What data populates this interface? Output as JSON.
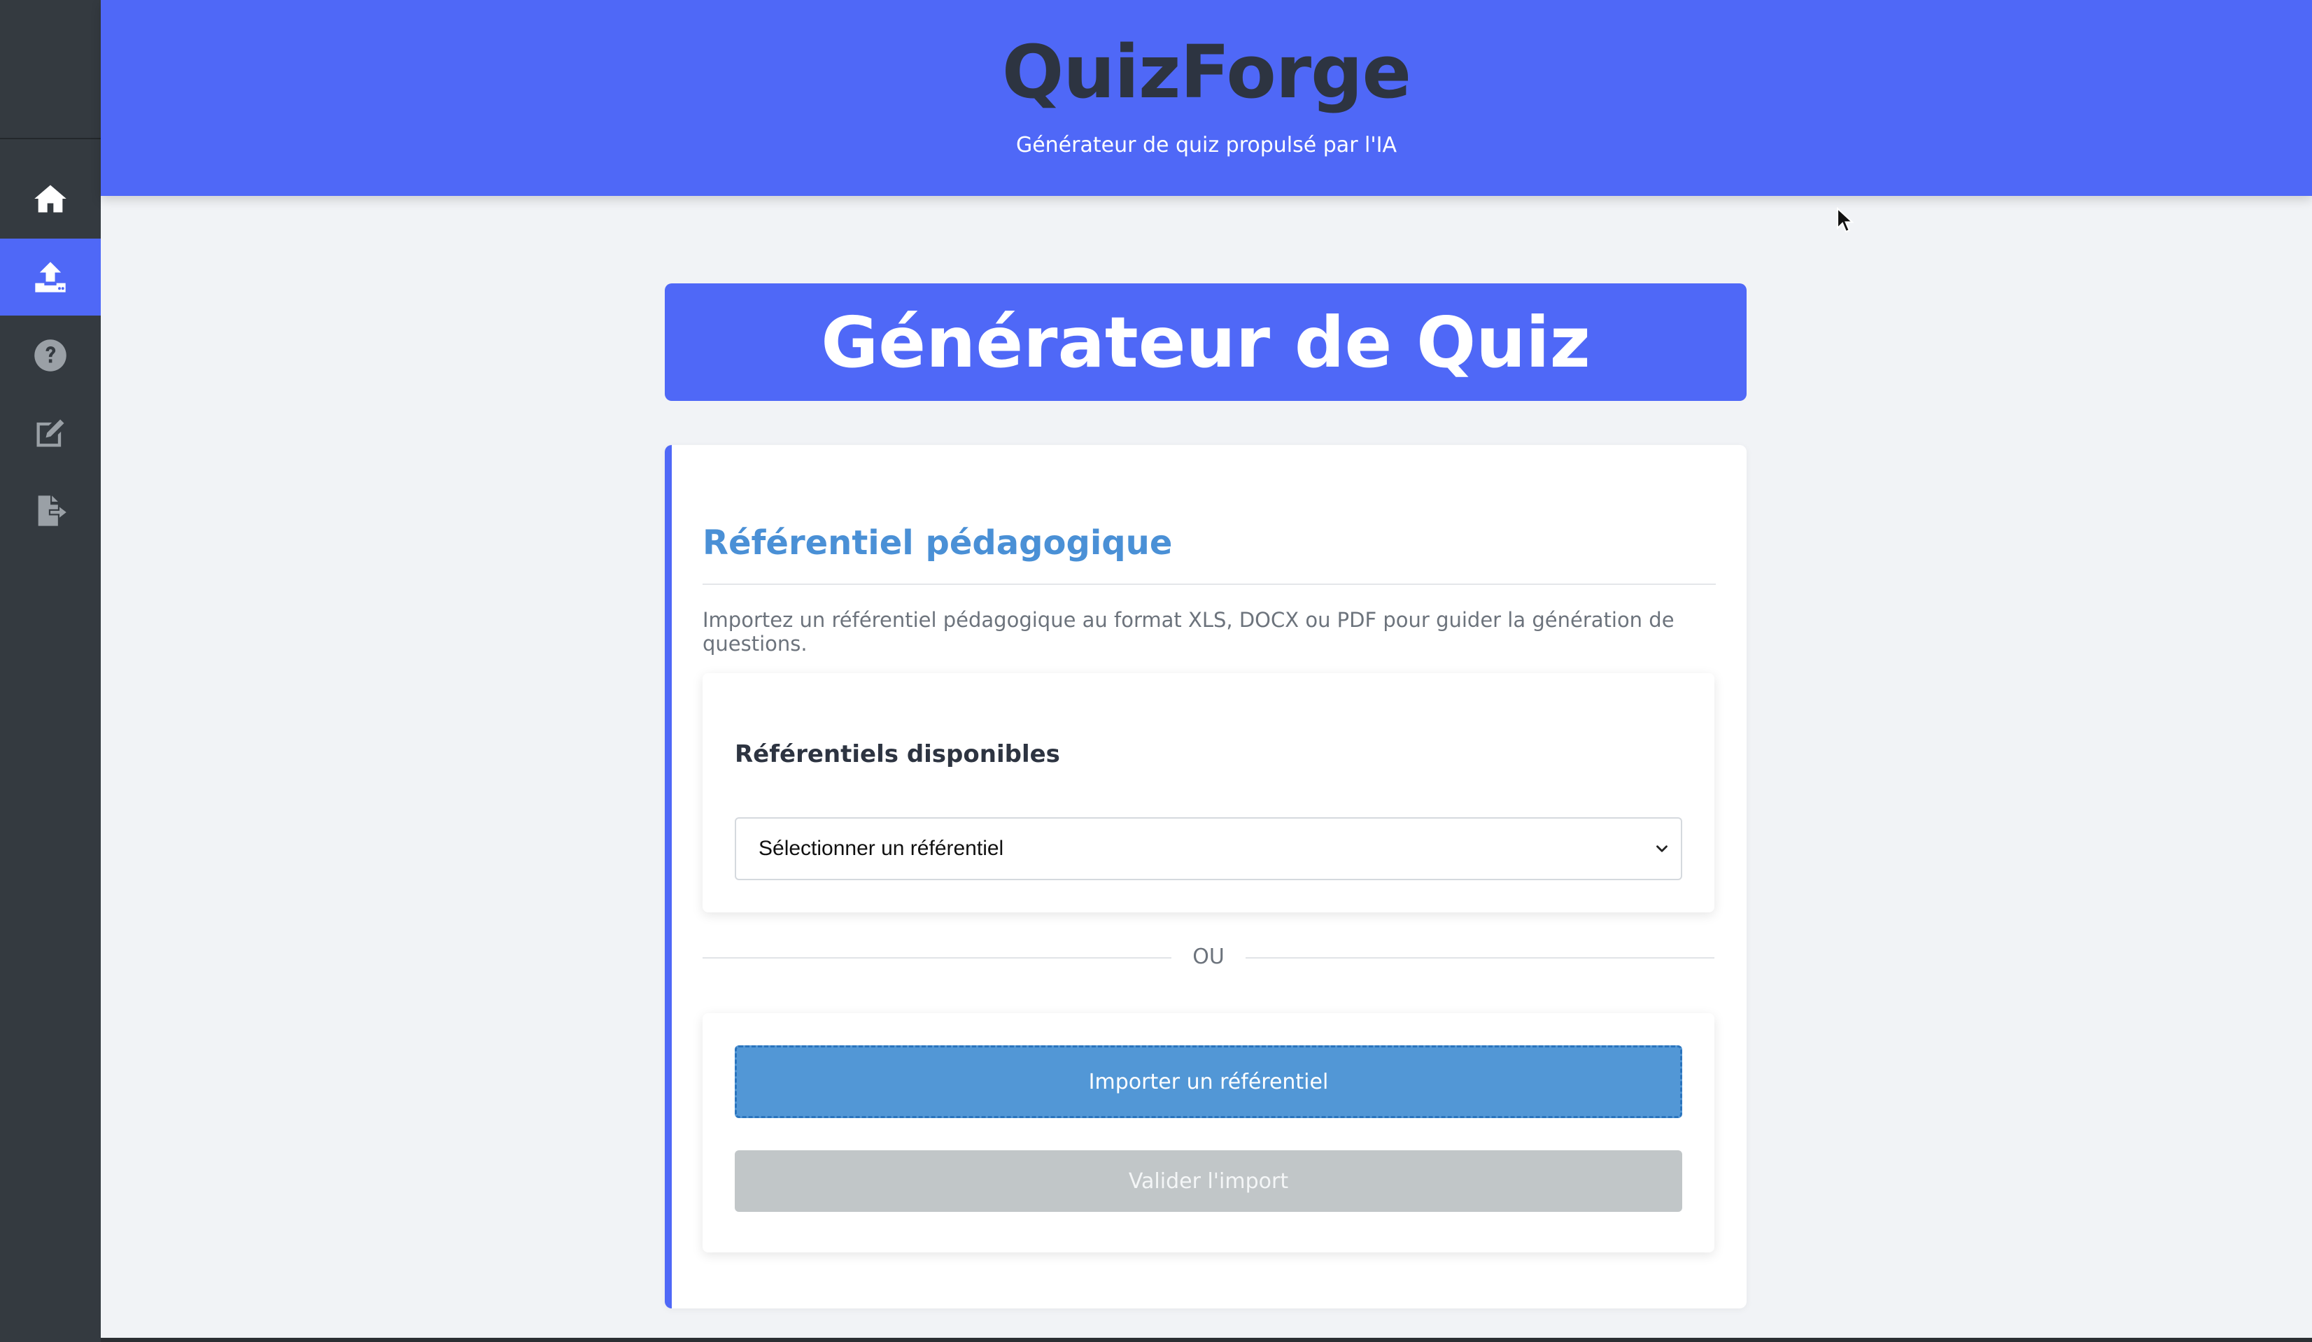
{
  "header": {
    "title": "QuizForge",
    "subtitle": "Générateur de quiz propulsé par l'IA"
  },
  "sidebar": {
    "items": [
      {
        "icon": "home-icon",
        "active": false
      },
      {
        "icon": "upload-icon",
        "active": true
      },
      {
        "icon": "question-circle-icon",
        "active": false
      },
      {
        "icon": "edit-icon",
        "active": false
      },
      {
        "icon": "file-export-icon",
        "active": false
      }
    ]
  },
  "banner": {
    "title": "Générateur de Quiz"
  },
  "referential": {
    "title": "Référentiel pédagogique",
    "description": "Importez un référentiel pédagogique au format XLS, DOCX ou PDF pour guider la génération de questions.",
    "available_label": "Référentiels disponibles",
    "select_value": "Sélectionner un référentiel",
    "divider_text": "OU",
    "import_button": "Importer un référentiel",
    "validate_button": "Valider l'import"
  },
  "colors": {
    "accent": "#4f68f7",
    "sidebar": "#343a40",
    "heading_blue": "#4a90d6",
    "import_button": "#5297d6",
    "disabled_button": "#c1c6c8"
  }
}
